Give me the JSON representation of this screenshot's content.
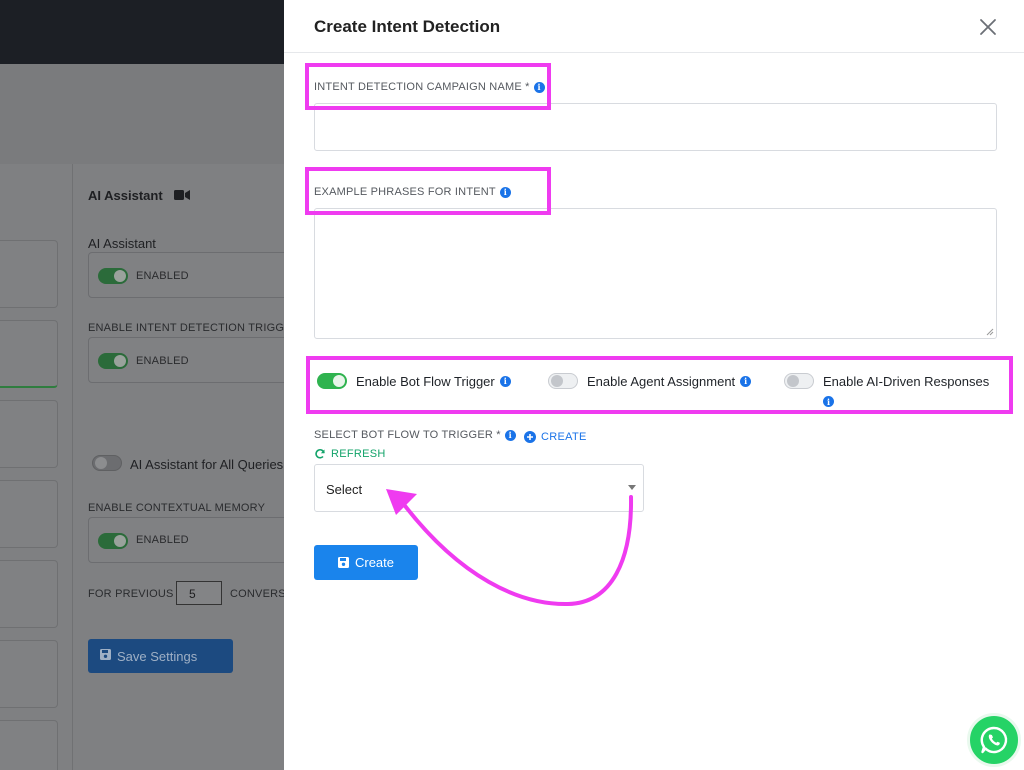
{
  "background": {
    "ai_assistant_title": "AI Assistant",
    "ai_assistant_label": "AI Assistant",
    "enabled_1": "ENABLED",
    "intent_trigger_label": "ENABLE INTENT DETECTION TRIGGE",
    "enabled_2": "ENABLED",
    "all_queries_label": "AI Assistant for All Queries",
    "contextual_memory_label": "ENABLE CONTEXTUAL MEMORY",
    "enabled_3": "ENABLED",
    "for_previous_label": "FOR PREVIOUS",
    "previous_count": "5",
    "conversations_label": "CONVERS",
    "save_settings": "Save Settings",
    "icons": {
      "video": "video-camera-icon",
      "save": "floppy-disk-icon"
    }
  },
  "modal": {
    "title": "Create Intent Detection",
    "campaign_name": {
      "label": "INTENT DETECTION CAMPAIGN NAME *",
      "value": ""
    },
    "example_phrases": {
      "label": "EXAMPLE PHRASES FOR INTENT",
      "value": ""
    },
    "toggles": [
      {
        "label": "Enable Bot Flow Trigger",
        "on": true
      },
      {
        "label": "Enable Agent Assignment",
        "on": false
      },
      {
        "label": "Enable AI-Driven Responses",
        "on": false
      }
    ],
    "bot_flow": {
      "label": "SELECT BOT FLOW TO TRIGGER *",
      "create_link": "CREATE",
      "refresh_link": "REFRESH",
      "selected": "Select"
    },
    "create_button": "Create",
    "icons": {
      "close": "close-icon",
      "info": "info-icon",
      "create": "plus-circle-icon",
      "refresh": "refresh-icon",
      "save": "floppy-disk-icon"
    }
  },
  "annotations": {
    "highlight_color": "#ef3bf0",
    "arrow_color": "#ef3bf0"
  },
  "accent_colors": {
    "primary": "#1a84ec",
    "toggle_on": "#2fb34f",
    "whatsapp": "#25d366"
  },
  "whatsapp_icon": "whatsapp-icon"
}
